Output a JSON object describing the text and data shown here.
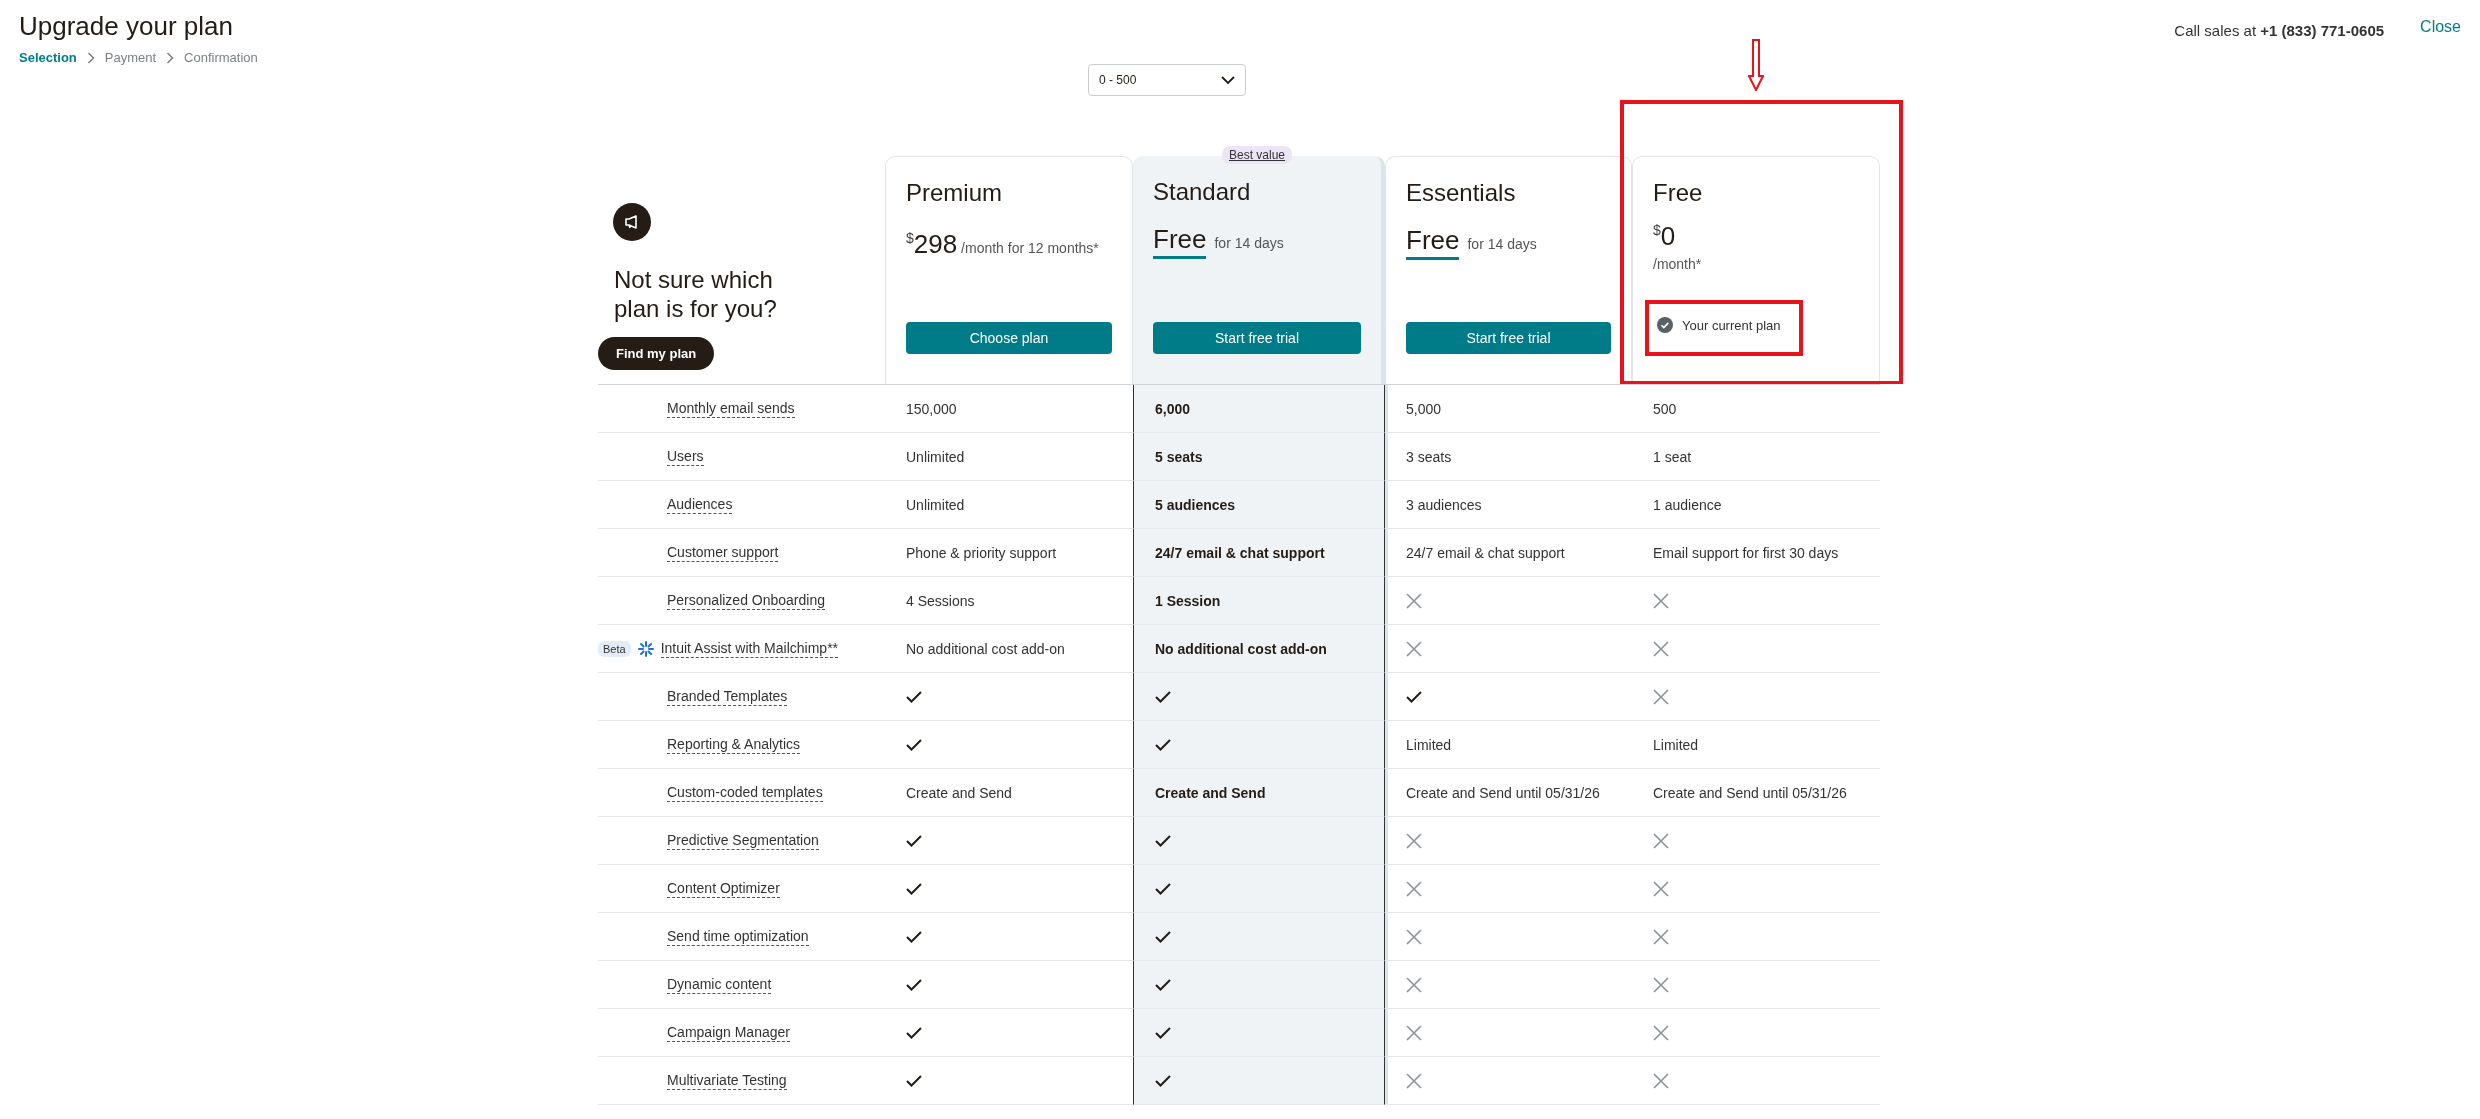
{
  "header": {
    "title": "Upgrade your plan",
    "steps": [
      {
        "label": "Selection",
        "selected": true
      },
      {
        "label": "Payment",
        "selected": false
      },
      {
        "label": "Confirmation",
        "selected": false
      }
    ],
    "sales_prefix": "Call sales at",
    "sales_phone": "+1 (833) 771-0605",
    "close": "Close"
  },
  "contacts_select": {
    "value": "0 - 500"
  },
  "helper": {
    "title": "Not sure which plan is for you?",
    "button": "Find my plan"
  },
  "plans": [
    {
      "name": "Premium",
      "featured": false,
      "highlighted": false,
      "price": {
        "kind": "amount",
        "currency": "$",
        "amount": "298",
        "period": "/month for 12 months*"
      },
      "action": {
        "kind": "button",
        "label": "Choose plan"
      }
    },
    {
      "name": "Standard",
      "featured": true,
      "badge": "Best value",
      "highlighted": false,
      "price": {
        "kind": "trial",
        "amount": "Free",
        "period": "for 14 days"
      },
      "action": {
        "kind": "button",
        "label": "Start free trial"
      }
    },
    {
      "name": "Essentials",
      "featured": false,
      "highlighted": false,
      "price": {
        "kind": "trial",
        "amount": "Free",
        "period": "for 14 days"
      },
      "action": {
        "kind": "button",
        "label": "Start free trial"
      }
    },
    {
      "name": "Free",
      "featured": false,
      "highlighted": true,
      "price": {
        "kind": "stacked",
        "currency": "$",
        "amount": "0",
        "period": "/month*"
      },
      "action": {
        "kind": "current",
        "label": "Your current plan",
        "highlighted": true
      }
    }
  ],
  "features": [
    {
      "name": "Monthly email sends",
      "cells": [
        {
          "kind": "text",
          "text": "150,000"
        },
        {
          "kind": "text",
          "text": "6,000"
        },
        {
          "kind": "text",
          "text": "5,000"
        },
        {
          "kind": "text",
          "text": "500"
        }
      ]
    },
    {
      "name": "Users",
      "cells": [
        {
          "kind": "text",
          "text": "Unlimited"
        },
        {
          "kind": "text",
          "text": "5 seats"
        },
        {
          "kind": "text",
          "text": "3 seats"
        },
        {
          "kind": "text",
          "text": "1 seat"
        }
      ]
    },
    {
      "name": "Audiences",
      "cells": [
        {
          "kind": "text",
          "text": "Unlimited"
        },
        {
          "kind": "text",
          "text": "5 audiences"
        },
        {
          "kind": "text",
          "text": "3 audiences"
        },
        {
          "kind": "text",
          "text": "1 audience"
        }
      ]
    },
    {
      "name": "Customer support",
      "cells": [
        {
          "kind": "text",
          "text": "Phone & priority support"
        },
        {
          "kind": "text",
          "text": "24/7 email & chat support"
        },
        {
          "kind": "text",
          "text": "24/7 email & chat support"
        },
        {
          "kind": "text",
          "text": "Email support for first 30 days"
        }
      ]
    },
    {
      "name": "Personalized Onboarding",
      "cells": [
        {
          "kind": "text",
          "text": "4 Sessions"
        },
        {
          "kind": "text",
          "text": "1 Session"
        },
        {
          "kind": "no"
        },
        {
          "kind": "no"
        }
      ]
    },
    {
      "name": "Intuit Assist with Mailchimp**",
      "tag": "Beta",
      "cells": [
        {
          "kind": "text",
          "text": "No additional cost add-on"
        },
        {
          "kind": "text",
          "text": "No additional cost add-on"
        },
        {
          "kind": "no"
        },
        {
          "kind": "no"
        }
      ]
    },
    {
      "name": "Branded Templates",
      "cells": [
        {
          "kind": "yes"
        },
        {
          "kind": "yes"
        },
        {
          "kind": "yes"
        },
        {
          "kind": "no"
        }
      ]
    },
    {
      "name": "Reporting & Analytics",
      "cells": [
        {
          "kind": "yes"
        },
        {
          "kind": "yes"
        },
        {
          "kind": "text",
          "text": "Limited"
        },
        {
          "kind": "text",
          "text": "Limited"
        }
      ]
    },
    {
      "name": "Custom-coded templates",
      "cells": [
        {
          "kind": "text",
          "text": "Create and Send"
        },
        {
          "kind": "text",
          "text": "Create and Send"
        },
        {
          "kind": "text",
          "text": "Create and Send until 05/31/26"
        },
        {
          "kind": "text",
          "text": "Create and Send until 05/31/26"
        }
      ]
    },
    {
      "name": "Predictive Segmentation",
      "cells": [
        {
          "kind": "yes"
        },
        {
          "kind": "yes"
        },
        {
          "kind": "no"
        },
        {
          "kind": "no"
        }
      ]
    },
    {
      "name": "Content Optimizer",
      "cells": [
        {
          "kind": "yes"
        },
        {
          "kind": "yes"
        },
        {
          "kind": "no"
        },
        {
          "kind": "no"
        }
      ]
    },
    {
      "name": "Send time optimization",
      "cells": [
        {
          "kind": "yes"
        },
        {
          "kind": "yes"
        },
        {
          "kind": "no"
        },
        {
          "kind": "no"
        }
      ]
    },
    {
      "name": "Dynamic content",
      "cells": [
        {
          "kind": "yes"
        },
        {
          "kind": "yes"
        },
        {
          "kind": "no"
        },
        {
          "kind": "no"
        }
      ]
    },
    {
      "name": "Campaign Manager",
      "cells": [
        {
          "kind": "yes"
        },
        {
          "kind": "yes"
        },
        {
          "kind": "no"
        },
        {
          "kind": "no"
        }
      ]
    },
    {
      "name": "Multivariate Testing",
      "cells": [
        {
          "kind": "yes"
        },
        {
          "kind": "yes"
        },
        {
          "kind": "no"
        },
        {
          "kind": "no"
        }
      ]
    }
  ]
}
